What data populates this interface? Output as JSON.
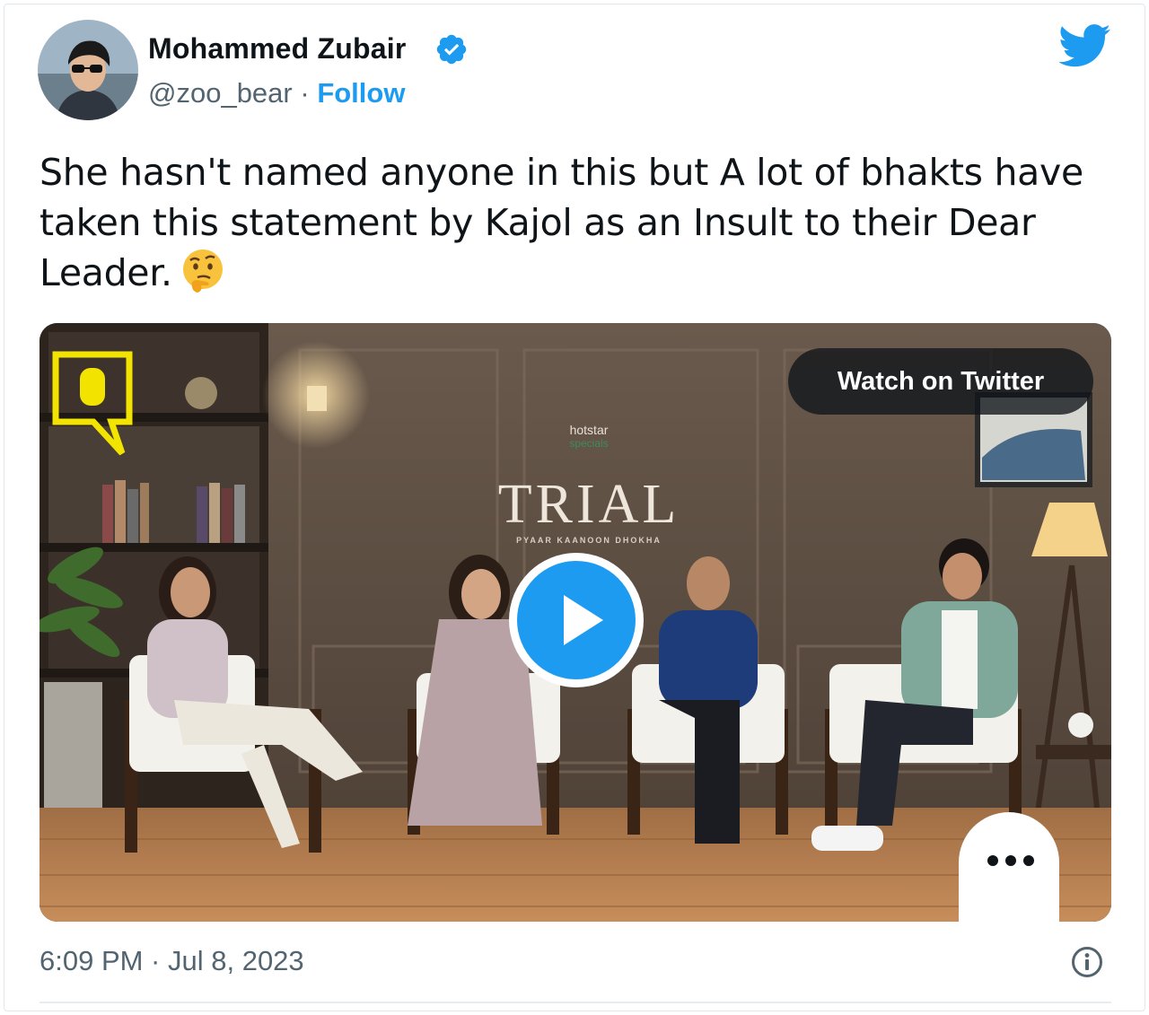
{
  "author": {
    "name": "Mohammed Zubair",
    "handle": "@zoo_bear",
    "separator": " · ",
    "follow_label": "Follow",
    "verified": true
  },
  "tweet": {
    "text": "She hasn't named anyone in this but A lot of bhakts have taken this statement by Kajol as an Insult to their Dear Leader.",
    "emoji": "thinking-face",
    "timestamp": "6:09 PM · Jul 8, 2023"
  },
  "media": {
    "watch_label": "Watch on Twitter",
    "show_brand": "hotstar specials",
    "show_title": "TRIAL",
    "show_tagline": "PYAAR  KAANOON  DHOKHA",
    "channel_logo": "Q",
    "people_count": 4
  },
  "icons": {
    "twitter_logo": "twitter-bird-icon",
    "verified": "verified-badge-icon",
    "play": "play-icon",
    "more": "more-dots-icon",
    "info": "info-icon"
  },
  "colors": {
    "accent": "#1d9bf0",
    "text": "#0f1419",
    "secondary": "#536471",
    "channel_logo": "#f2e400"
  }
}
